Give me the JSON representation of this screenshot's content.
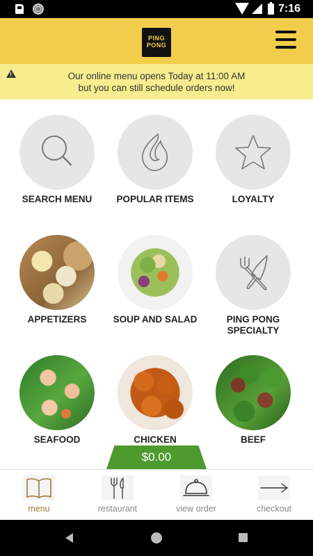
{
  "status_bar": {
    "time": "7:16"
  },
  "header": {
    "logo_line1": "PING",
    "logo_line2": "PONG"
  },
  "notice": {
    "line1": "Our online menu opens Today at 11:00 AM",
    "line2": "but you can still schedule orders now!"
  },
  "tiles": [
    {
      "label": "SEARCH MENU"
    },
    {
      "label": "POPULAR ITEMS"
    },
    {
      "label": "LOYALTY"
    },
    {
      "label": "APPETIZERS"
    },
    {
      "label": "SOUP AND SALAD"
    },
    {
      "label": "PING PONG SPECIALTY"
    },
    {
      "label": "SEAFOOD"
    },
    {
      "label": "CHICKEN"
    },
    {
      "label": "BEEF"
    }
  ],
  "cart": {
    "total": "$0.00"
  },
  "bottom_nav": [
    {
      "label": "menu",
      "icon": "book-icon",
      "active": true
    },
    {
      "label": "restaurant",
      "icon": "utensils-icon",
      "active": false
    },
    {
      "label": "view order",
      "icon": "cloche-icon",
      "active": false
    },
    {
      "label": "checkout",
      "icon": "arrow-right-icon",
      "active": false
    }
  ],
  "colors": {
    "header_bg": "#f2cd4b",
    "notice_bg": "#f7ed8e",
    "cart_bg": "#4e9a2e",
    "active_nav": "#a0783a"
  }
}
